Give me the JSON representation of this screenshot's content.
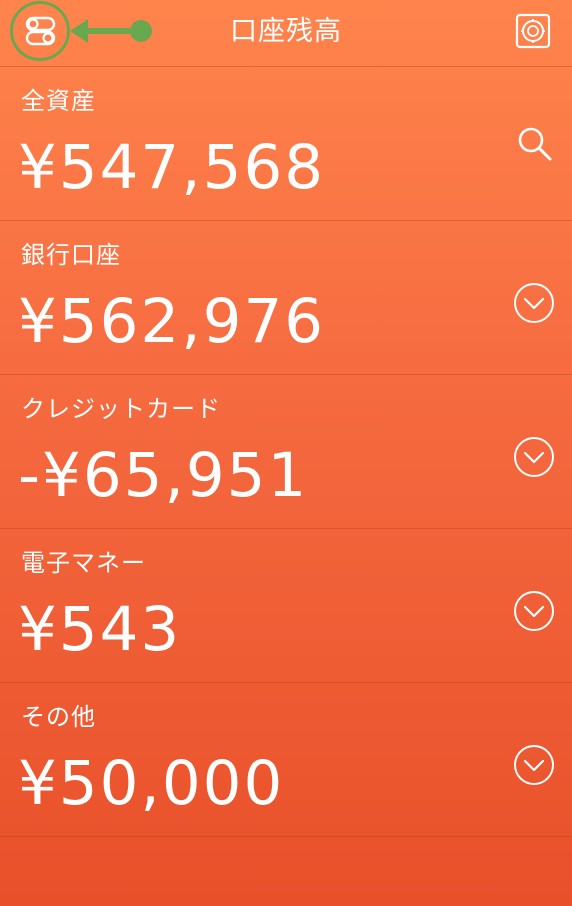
{
  "header": {
    "title": "口座残高",
    "menu_icon": "toggles-icon",
    "settings_icon": "safe-icon",
    "highlight_color": "#6aa84f"
  },
  "rows": [
    {
      "label": "全資産",
      "amount": "¥547,568",
      "action_icon": "search-icon"
    },
    {
      "label": "銀行口座",
      "amount": "¥562,976",
      "action_icon": "chevron-down-circle-icon"
    },
    {
      "label": "クレジットカード",
      "amount": "-¥65,951",
      "action_icon": "chevron-down-circle-icon"
    },
    {
      "label": "電子マネー",
      "amount": "¥543",
      "action_icon": "chevron-down-circle-icon"
    },
    {
      "label": "その他",
      "amount": "¥50,000",
      "action_icon": "chevron-down-circle-icon"
    }
  ],
  "colors": {
    "gradient_top": "#ff844c",
    "gradient_bottom": "#e8502a",
    "text": "#ffffff"
  }
}
